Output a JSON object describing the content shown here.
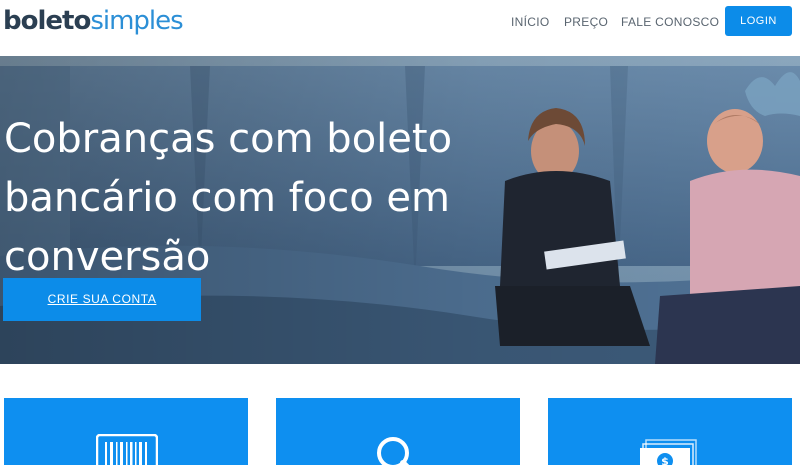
{
  "header": {
    "logo": {
      "part1": "boleto",
      "part2": "simples"
    },
    "nav": [
      {
        "label": "INÍCIO"
      },
      {
        "label": "PREÇO"
      },
      {
        "label": "FALE CONOSCO"
      }
    ],
    "login_label": "LOGIN"
  },
  "hero": {
    "title_lines": [
      "Cobranças com boleto",
      "bancário com foco em",
      "conversão"
    ],
    "cta_label": "CRIE SUA CONTA"
  },
  "features": [
    {
      "icon": "barcode-icon"
    },
    {
      "icon": "magnifier-icon"
    },
    {
      "icon": "money-stack-icon"
    }
  ],
  "colors": {
    "brand_blue": "#0c8ce9",
    "logo_dark": "#2b3f52",
    "logo_light": "#2c8fd6",
    "card_blue": "#0e8ff0"
  }
}
